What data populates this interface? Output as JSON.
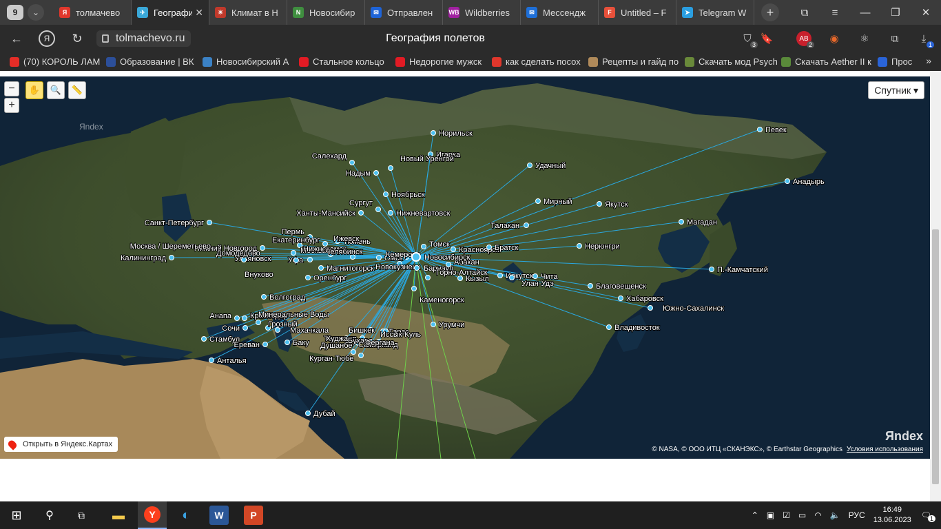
{
  "tabbar": {
    "tab_count": "9",
    "tabs": [
      {
        "label": "толмачево",
        "color": "#e0372c",
        "glyph": "Я"
      },
      {
        "label": "География полетов",
        "color": "#3aa8d8",
        "glyph": "✈",
        "active": true
      },
      {
        "label": "Климат в Н",
        "color": "#c0392b",
        "glyph": "☀"
      },
      {
        "label": "Новосибир",
        "color": "#3f8e3f",
        "glyph": "N"
      },
      {
        "label": "Отправлен",
        "color": "#1e64d8",
        "glyph": "✉"
      },
      {
        "label": "Wildberries",
        "color": "#a020a0",
        "glyph": "WB"
      },
      {
        "label": "Мессендж",
        "color": "#1e6fd8",
        "glyph": "✉"
      },
      {
        "label": "Untitled – F",
        "color": "#e7503a",
        "glyph": "F"
      },
      {
        "label": "Telegram W",
        "color": "#2a9ee0",
        "glyph": "➤"
      }
    ]
  },
  "address": {
    "url": "tolmachevo.ru",
    "title": "География полетов",
    "badge_shield": "3",
    "badge_ext": "2",
    "badge_notif": "1"
  },
  "bookmarks": [
    {
      "label": "(70) КОРОЛЬ ЛАМ",
      "color": "#e52d27"
    },
    {
      "label": "Образование | ВК",
      "color": "#2c4f9a"
    },
    {
      "label": "Новосибирский А",
      "color": "#3b82c6"
    },
    {
      "label": "Стальное кольцо",
      "color": "#e21b24"
    },
    {
      "label": "Недорогие мужск",
      "color": "#e21b24"
    },
    {
      "label": "как сделать посох",
      "color": "#e0372c"
    },
    {
      "label": "Рецепты и гайд по",
      "color": "#b08a5a"
    },
    {
      "label": "Скачать мод Psych",
      "color": "#6a8a3a"
    },
    {
      "label": "Скачать Aether II к",
      "color": "#5a8a3a"
    },
    {
      "label": "Прос",
      "color": "#2a64d8"
    }
  ],
  "map": {
    "layer_label": "Спутник",
    "open_in_maps": "Открыть в Яндекс.Картах",
    "copyright": "© NASA, © ООО ИТЦ «СКАНЭКС», © Earthstar Geographics",
    "terms": "Условия использования",
    "watermark": "Яndex",
    "hub": "Новосибирск",
    "cities": [
      {
        "name": "Норильск"
      },
      {
        "name": "Игарка"
      },
      {
        "name": "Салехард"
      },
      {
        "name": "Надым"
      },
      {
        "name": "Новый Уренгой"
      },
      {
        "name": "Ноябрьск"
      },
      {
        "name": "Сургут"
      },
      {
        "name": "Ханты-Мансийск"
      },
      {
        "name": "Нижневартовск"
      },
      {
        "name": "Санкт-Петербург"
      },
      {
        "name": "Пермь"
      },
      {
        "name": "Тюмень"
      },
      {
        "name": "Екатеринбург"
      },
      {
        "name": "Ижевск"
      },
      {
        "name": "Нижний Новгород"
      },
      {
        "name": "Москва / Шереметьево"
      },
      {
        "name": "Москва"
      },
      {
        "name": "Нижнекамск"
      },
      {
        "name": "Челябинск"
      },
      {
        "name": "Омск"
      },
      {
        "name": "Кемерово"
      },
      {
        "name": "Томск"
      },
      {
        "name": "Красноярск"
      },
      {
        "name": "Братск"
      },
      {
        "name": "Калининград"
      },
      {
        "name": "Ульяновск"
      },
      {
        "name": "Уфа"
      },
      {
        "name": "Домодедово"
      },
      {
        "name": "Внуково"
      },
      {
        "name": "Магнитогорск"
      },
      {
        "name": "Новокузнецк"
      },
      {
        "name": "Барнаул"
      },
      {
        "name": "Абакан"
      },
      {
        "name": "Оренбург"
      },
      {
        "name": "Горно-Алтайск"
      },
      {
        "name": "Кызыл"
      },
      {
        "name": "Иркутск"
      },
      {
        "name": "Улан-Удэ"
      },
      {
        "name": "Чита"
      },
      {
        "name": "Волгоград"
      },
      {
        "name": "Каменогорск"
      },
      {
        "name": "Анапа"
      },
      {
        "name": "Краснодар"
      },
      {
        "name": "Минеральные Воды"
      },
      {
        "name": "Сочи"
      },
      {
        "name": "Грозный"
      },
      {
        "name": "Махачкала"
      },
      {
        "name": "Стамбул"
      },
      {
        "name": "Ереван"
      },
      {
        "name": "Баку"
      },
      {
        "name": "Анталья"
      },
      {
        "name": "Бишкек"
      },
      {
        "name": "Тараз"
      },
      {
        "name": "Иссык-Куль"
      },
      {
        "name": "Ташкент"
      },
      {
        "name": "Худжанд"
      },
      {
        "name": "Бухара"
      },
      {
        "name": "Самарканд"
      },
      {
        "name": "Фергана"
      },
      {
        "name": "Душанбе"
      },
      {
        "name": "Курган-Тюбе"
      },
      {
        "name": "Урумчи"
      },
      {
        "name": "Дубай"
      },
      {
        "name": "Удачный"
      },
      {
        "name": "Мирный"
      },
      {
        "name": "Якутск"
      },
      {
        "name": "Талакан"
      },
      {
        "name": "Нерюнгри"
      },
      {
        "name": "Благовещенск"
      },
      {
        "name": "Хабаровск"
      },
      {
        "name": "Владивосток"
      },
      {
        "name": "Южно-Сахалинск"
      },
      {
        "name": "П.-Камчатский"
      },
      {
        "name": "Магадан"
      },
      {
        "name": "Певек"
      },
      {
        "name": "Анадырь"
      }
    ]
  },
  "taskbar": {
    "lang": "РУС",
    "time": "16:49",
    "date": "13.06.2023",
    "notif_count": "1"
  },
  "colors": {
    "route": "#2aa8e0",
    "route_alt": "#6fd24a",
    "chrome_bg": "#2b2b2b"
  }
}
